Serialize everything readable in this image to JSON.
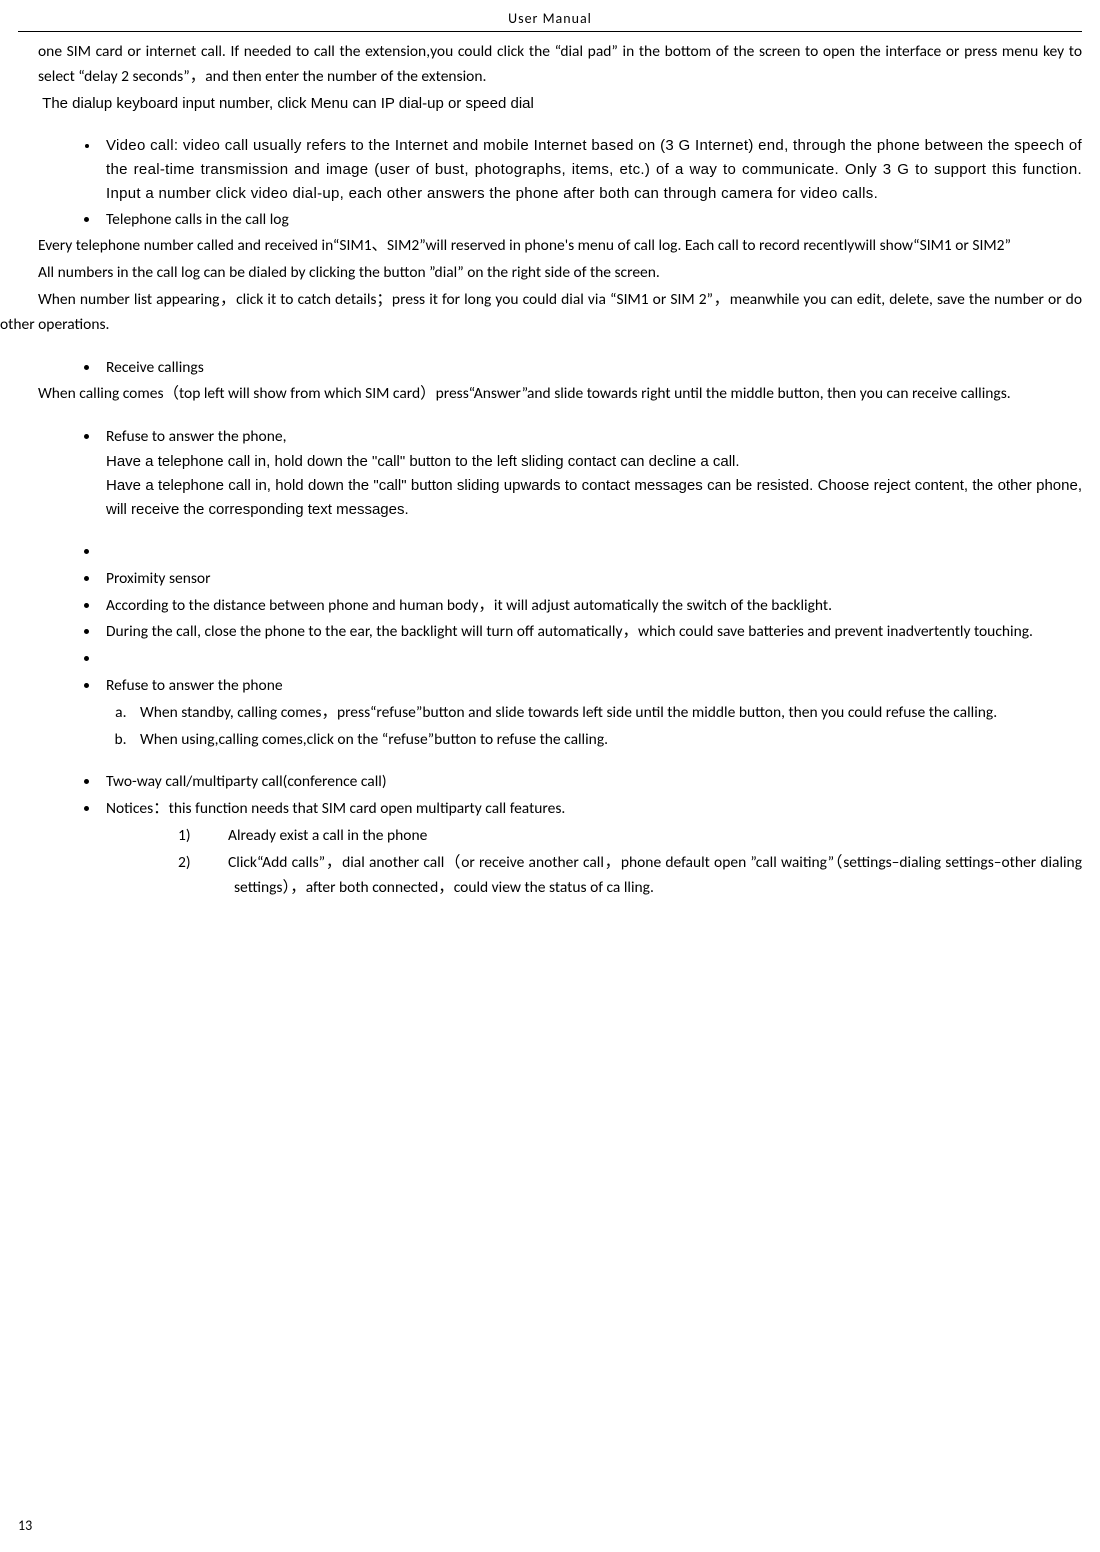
{
  "header": "User    Manual",
  "intro": {
    "p1": "one SIM card or internet call. If needed to call the extension,you could click the “dial pad” in the bottom of the screen to open the interface or press menu key to select “delay 2 seconds”，and then enter the number of the extension.",
    "p2": "The dialup keyboard input number, click Menu can IP dial-up or speed dial"
  },
  "list1": {
    "video_call": "Video call: video call usually refers to the Internet and mobile Internet based on (3 G Internet) end, through the phone between the speech of the real-time transmission and image (user of bust, photographs, items, etc.) of a way to communicate. Only 3 G to support this function. Input a number click video dial-up, each other answers the phone after both can through camera for video calls.",
    "telephone_calls": "Telephone calls in the call log"
  },
  "call_log": {
    "p1": "Every telephone number called and received in“SIM1、SIM2”will reserved in phone's menu of call log. Each call to record recentlywill show“SIM1 or SIM2”",
    "p2": "All numbers in the call log can be dialed by clicking the button ”dial” on the right side of the screen.",
    "p3": "When number list appearing，click it to catch details；press it for long you could dial via “SIM1 or SIM 2”，meanwhile you can edit, delete, save the number or do other operations."
  },
  "receive": {
    "title": "Receive callings",
    "p1": "When calling comes（top left will show from which SIM card）press“Answer”and slide towards right until the middle button, then you can receive callings."
  },
  "refuse1": {
    "title": "Refuse to answer the phone,",
    "p1": "Have a telephone call in, hold down the \"call\" button to the left sliding contact can decline a call.",
    "p2": "Have a telephone call in, hold down the \"call\" button sliding upwards to contact messages can be resisted. Choose reject content, the other phone, will receive the corresponding text messages."
  },
  "proximity": {
    "title": "Proximity sensor",
    "p1": "According to the distance between phone and human body，it will adjust automatically the switch of the backlight.",
    "p2": "During the call, close the phone to the ear, the backlight will turn off automatically，which could save batteries and prevent inadvertently touching."
  },
  "refuse2": {
    "title": "Refuse to answer the phone",
    "a": "When standby, calling comes，press“refuse”button and slide towards left side until the middle button, then you could refuse the calling.",
    "b": "When using,calling comes,click on the “refuse”button to refuse the calling."
  },
  "conference": {
    "title": "Two-way call/multiparty call(conference call)",
    "notices": "Notices：this function needs that SIM card open multiparty call features.",
    "n1": "Already exist a call in the phone",
    "n2": "Click“Add calls”，dial another call（or receive another call，phone default open ”call waiting”（settings–dialing settings–other dialing settings），after both connected，could view the status of ca    lling."
  },
  "page_number": "13"
}
